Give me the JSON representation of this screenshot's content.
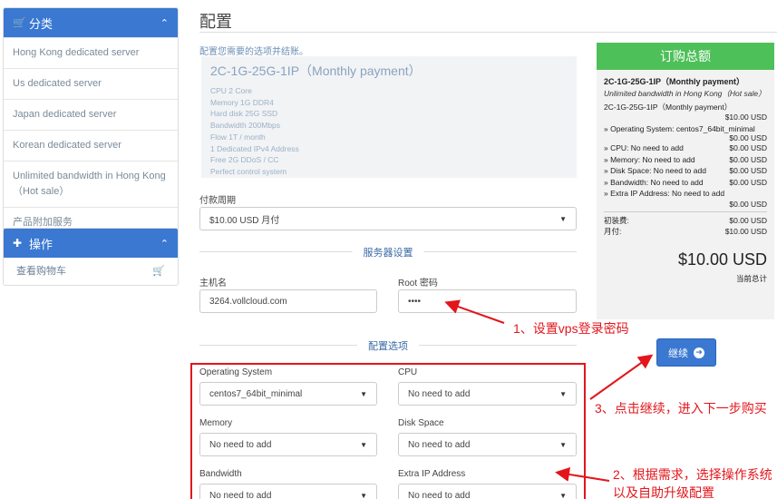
{
  "sidebar": {
    "categories_title": "分类",
    "categories": [
      "Hong Kong dedicated server",
      "Us dedicated server",
      "Japan dedicated server",
      "Korean dedicated server",
      "Unlimited bandwidth in Hong Kong（Hot sale）",
      "产品附加服务"
    ],
    "actions_title": "操作",
    "actions": [
      "查看购物车"
    ]
  },
  "main": {
    "title": "配置",
    "intro": "配置您需要的选项并结账。",
    "product": {
      "name": "2C-1G-25G-1IP（Monthly payment）",
      "features": [
        "CPU 2 Core",
        "Memory 1G DDR4",
        "Hard disk 25G SSD",
        "Bandwidth 200Mbps",
        "Flow 1T / month",
        "1 Dedicated IPv4 Address",
        "Free 2G DDoS / CC",
        "Perfect control system"
      ]
    },
    "billing": {
      "label": "付款周期",
      "value": "$10.00 USD 月付"
    },
    "server_section": "服务器设置",
    "hostname": {
      "label": "主机名",
      "value": "3264.vollcloud.com"
    },
    "root_password": {
      "label": "Root 密码",
      "value": "••••"
    },
    "options_section": "配置选项",
    "options": {
      "os": {
        "label": "Operating System",
        "value": "centos7_64bit_minimal"
      },
      "cpu": {
        "label": "CPU",
        "value": "No need to add"
      },
      "memory": {
        "label": "Memory",
        "value": "No need to add"
      },
      "disk": {
        "label": "Disk Space",
        "value": "No need to add"
      },
      "bandwidth": {
        "label": "Bandwidth",
        "value": "No need to add"
      },
      "ip": {
        "label": "Extra IP Address",
        "value": "No need to add"
      }
    }
  },
  "summary": {
    "title": "订购总额",
    "product": "2C-1G-25G-1IP（Monthly payment）",
    "desc": "Unlimited bandwidth in Hong Kong（Hot sale）",
    "line_name": "2C-1G-25G-1IP（Monthly payment）",
    "line_price": "$10.00 USD",
    "os_line": "» Operating System: centos7_64bit_minimal",
    "os_price": "$0.00 USD",
    "rows": [
      {
        "label": "» CPU: No need to add",
        "price": "$0.00 USD"
      },
      {
        "label": "» Memory: No need to add",
        "price": "$0.00 USD"
      },
      {
        "label": "» Disk Space: No need to add",
        "price": "$0.00 USD"
      },
      {
        "label": "» Bandwidth: No need to add",
        "price": "$0.00 USD"
      },
      {
        "label": "» Extra IP Address: No need to add",
        "price": ""
      }
    ],
    "extra_ip_price": "$0.00 USD",
    "setup_label": "初装费:",
    "setup_price": "$0.00 USD",
    "monthly_label": "月付:",
    "monthly_price": "$10.00 USD",
    "total": "$10.00 USD",
    "total_label": "当前总计"
  },
  "continue_label": "继续",
  "annotations": {
    "a1": "1、设置vps登录密码",
    "a2": "2、根据需求，选择操作系统以及自助升级配置",
    "a3": "3、点击继续，进入下一步购买"
  },
  "colors": {
    "accent": "#3a78d2",
    "green": "#4ec05a",
    "annotation_red": "#e2161c"
  }
}
